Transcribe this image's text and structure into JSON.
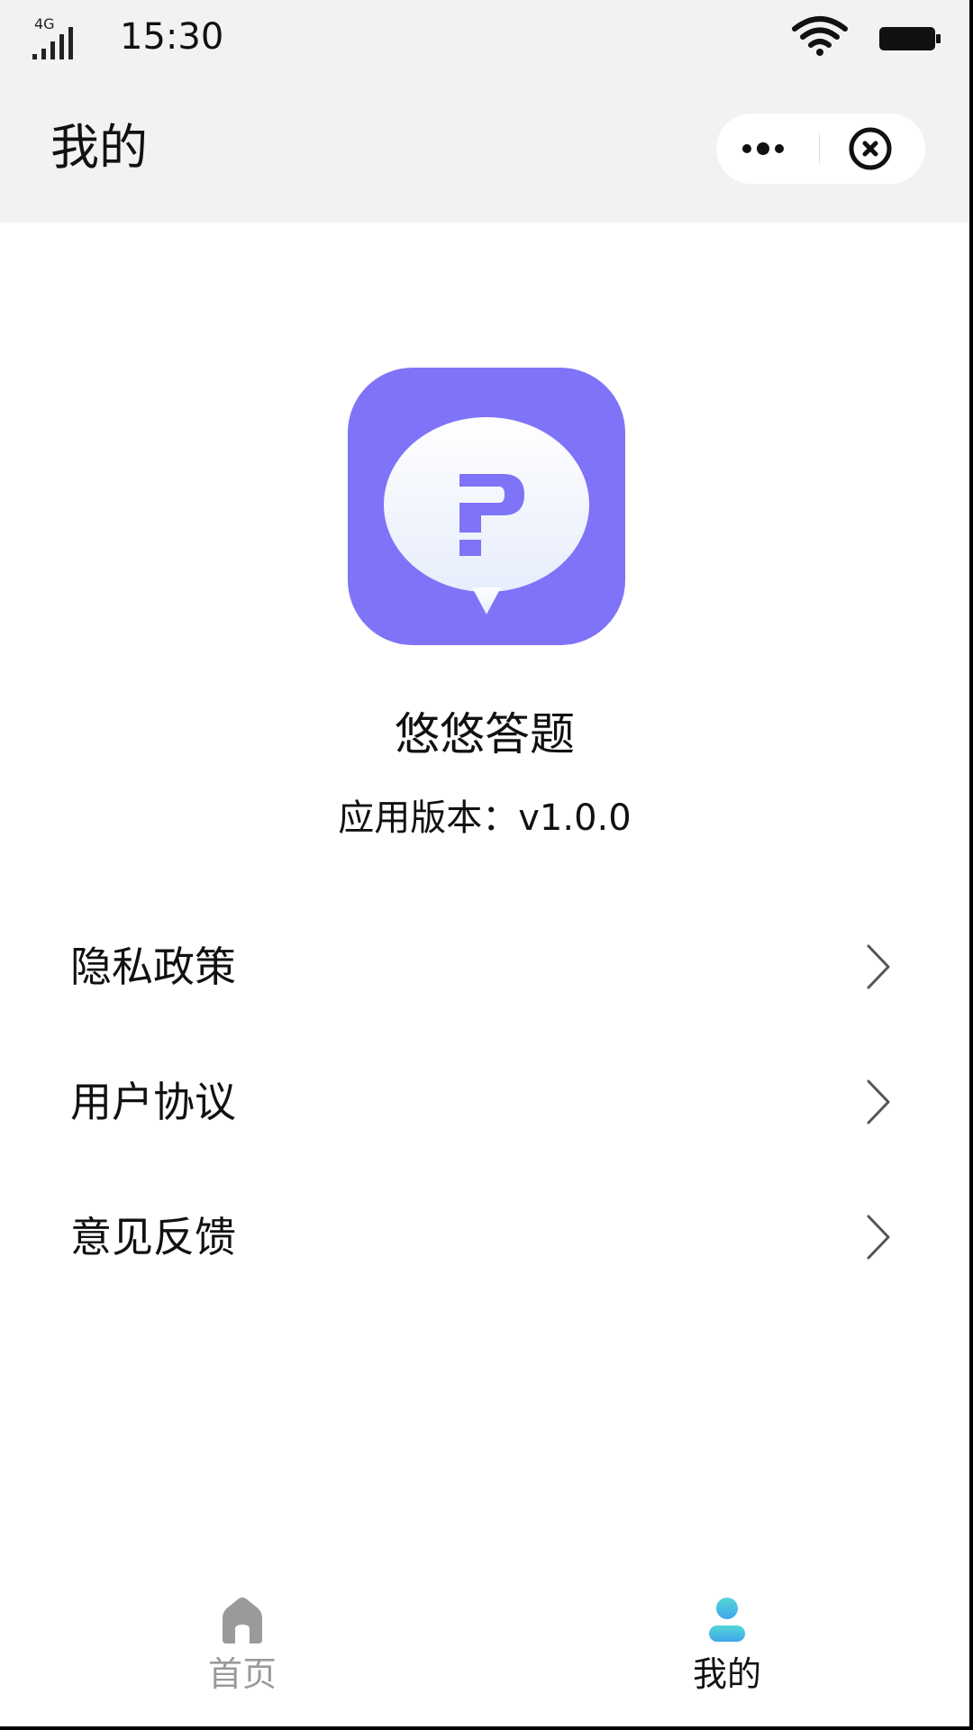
{
  "status_bar": {
    "network": "4G",
    "time": "15:30",
    "signal_icon": "signal-icon",
    "wifi_icon": "wifi-icon",
    "battery_icon": "battery-icon"
  },
  "nav": {
    "title": "我的",
    "more_icon": "more-dots-icon",
    "close_icon": "close-circle-icon"
  },
  "app": {
    "name": "悠悠答题",
    "version": "应用版本：v1.0.0",
    "logo_icon": "question-chat-bubble-icon",
    "logo_color": "#7f73f7"
  },
  "menu": [
    {
      "label": "隐私政策",
      "icon": "chevron-right-icon"
    },
    {
      "label": "用户协议",
      "icon": "chevron-right-icon"
    },
    {
      "label": "意见反馈",
      "icon": "chevron-right-icon"
    }
  ],
  "tabbar": {
    "items": [
      {
        "label": "首页",
        "icon": "home-icon",
        "active": false,
        "color": "#9a9a9a"
      },
      {
        "label": "我的",
        "icon": "user-icon",
        "active": true,
        "color": "#111111"
      }
    ],
    "active_icon_color": "#47bde6"
  }
}
